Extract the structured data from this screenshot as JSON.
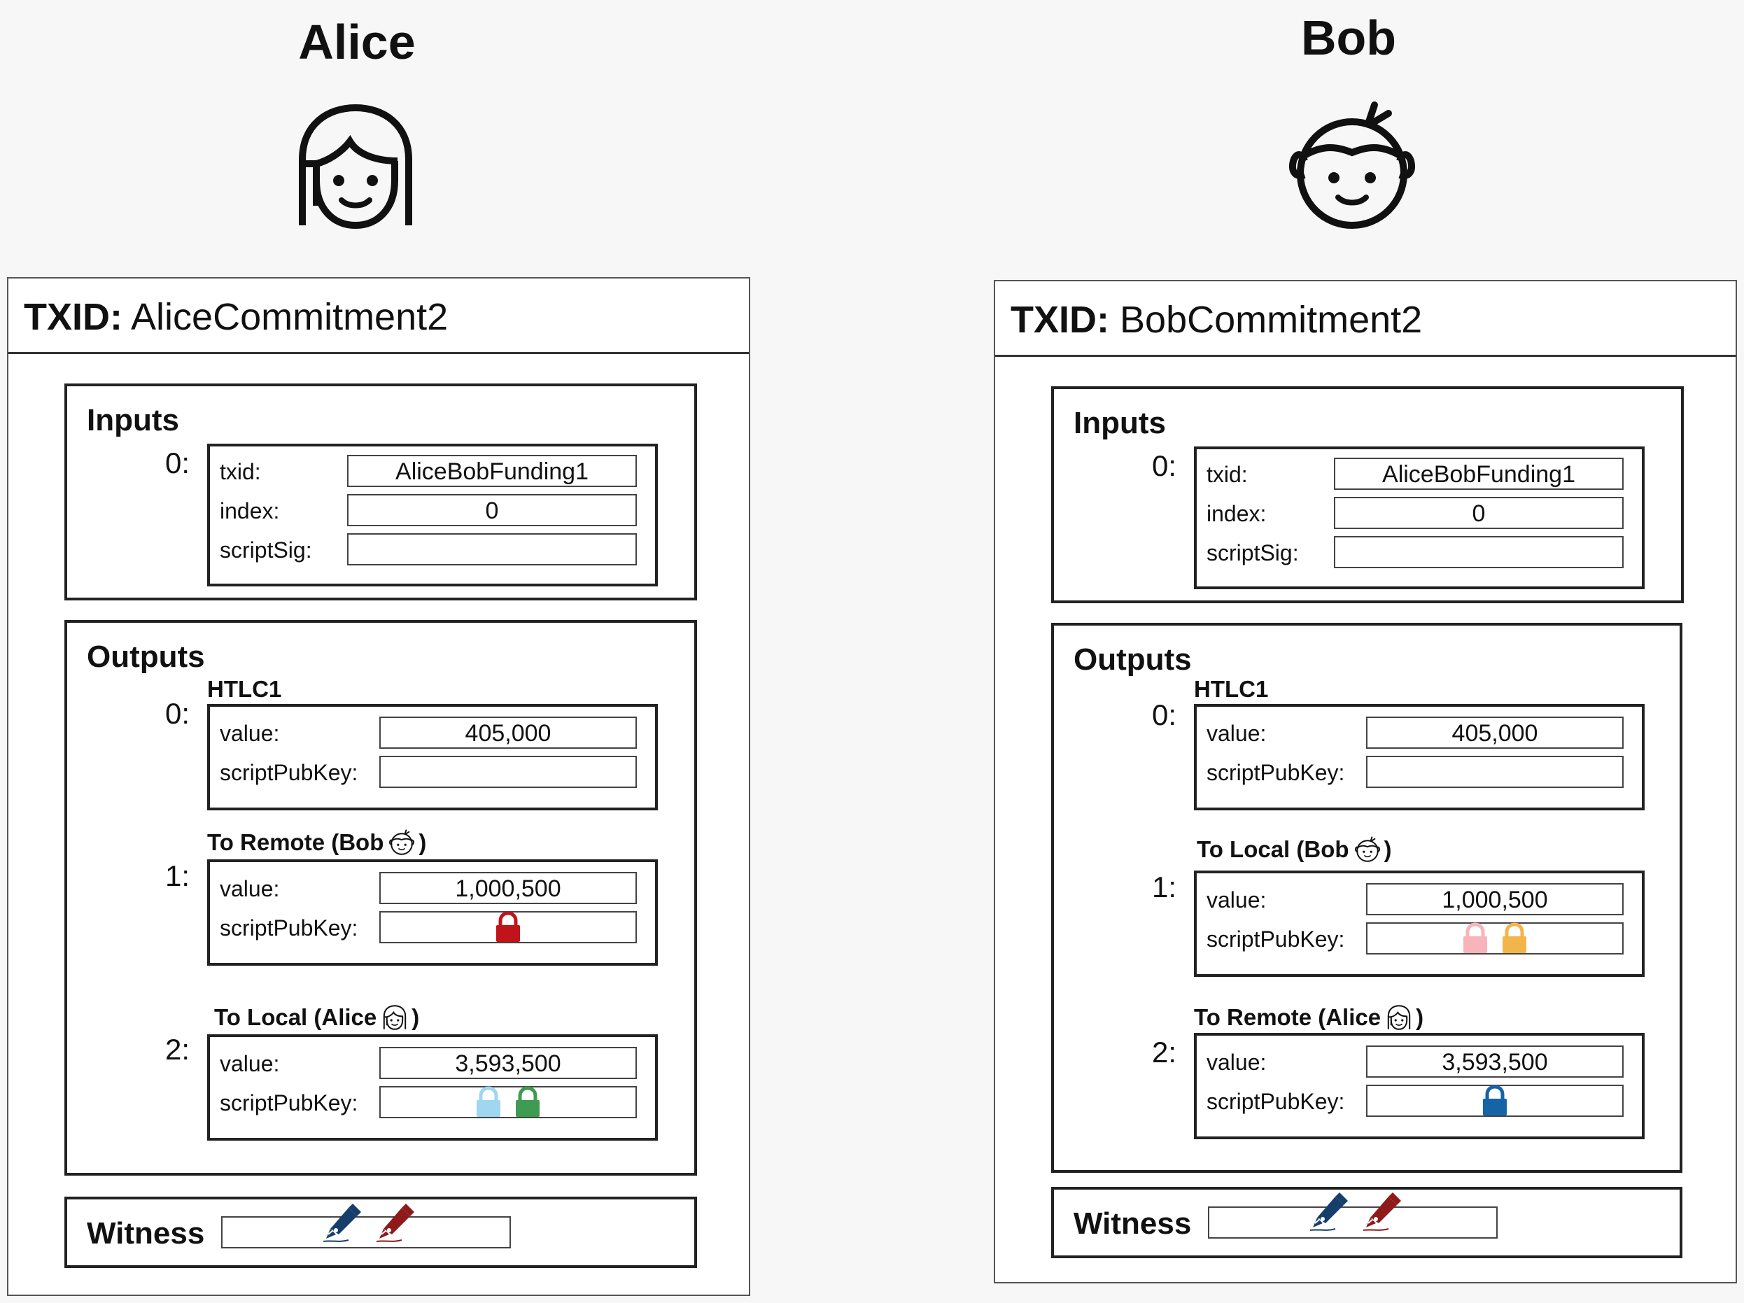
{
  "colors": {
    "lock_red": "#c0141a",
    "lock_light_blue": "#9fd6f0",
    "lock_green": "#3f9a52",
    "lock_pink": "#f7b4bb",
    "lock_orange": "#f3b54a",
    "lock_blue": "#1565a6",
    "pen_blue": "#153e6b",
    "pen_red": "#8f1a1a"
  },
  "alice": {
    "name": "Alice",
    "avatar_icon": "alice-face-icon",
    "tx": {
      "txid_label": "TXID:",
      "txid": "AliceCommitment2",
      "inputs_title": "Inputs",
      "input_index": "0:",
      "txid_field_label": "txid:",
      "txid_value": "AliceBobFunding1",
      "index_field_label": "index:",
      "index_value": "0",
      "scriptsig_label": "scriptSig:",
      "scriptsig_value": "",
      "outputs_title": "Outputs",
      "outputs": [
        {
          "index": "0:",
          "label": "HTLC1",
          "value_label": "value:",
          "value": "405,000",
          "spk_label": "scriptPubKey:",
          "locks": []
        },
        {
          "index": "1:",
          "label_prefix": "To Remote (Bob",
          "label_suffix": ")",
          "value_label": "value:",
          "value": "1,000,500",
          "spk_label": "scriptPubKey:",
          "locks": [
            "lock_red"
          ]
        },
        {
          "index": "2:",
          "label_prefix": "To Local (Alice",
          "label_suffix": ")",
          "value_label": "value:",
          "value": "3,593,500",
          "spk_label": "scriptPubKey:",
          "locks": [
            "lock_light_blue",
            "lock_green"
          ]
        }
      ],
      "witness_label": "Witness",
      "witness_icons": [
        "pen_blue",
        "pen_red"
      ]
    }
  },
  "bob": {
    "name": "Bob",
    "avatar_icon": "bob-face-icon",
    "tx": {
      "txid_label": "TXID:",
      "txid": "BobCommitment2",
      "inputs_title": "Inputs",
      "input_index": "0:",
      "txid_field_label": "txid:",
      "txid_value": "AliceBobFunding1",
      "index_field_label": "index:",
      "index_value": "0",
      "scriptsig_label": "scriptSig:",
      "scriptsig_value": "",
      "outputs_title": "Outputs",
      "outputs": [
        {
          "index": "0:",
          "label": "HTLC1",
          "value_label": "value:",
          "value": "405,000",
          "spk_label": "scriptPubKey:",
          "locks": []
        },
        {
          "index": "1:",
          "label_prefix": "To Local (Bob",
          "label_suffix": ")",
          "value_label": "value:",
          "value": "1,000,500",
          "spk_label": "scriptPubKey:",
          "locks": [
            "lock_pink",
            "lock_orange"
          ]
        },
        {
          "index": "2:",
          "label_prefix": "To Remote (Alice",
          "label_suffix": ")",
          "value_label": "value:",
          "value": "3,593,500",
          "spk_label": "scriptPubKey:",
          "locks": [
            "lock_blue"
          ]
        }
      ],
      "witness_label": "Witness",
      "witness_icons": [
        "pen_blue",
        "pen_red"
      ]
    }
  }
}
